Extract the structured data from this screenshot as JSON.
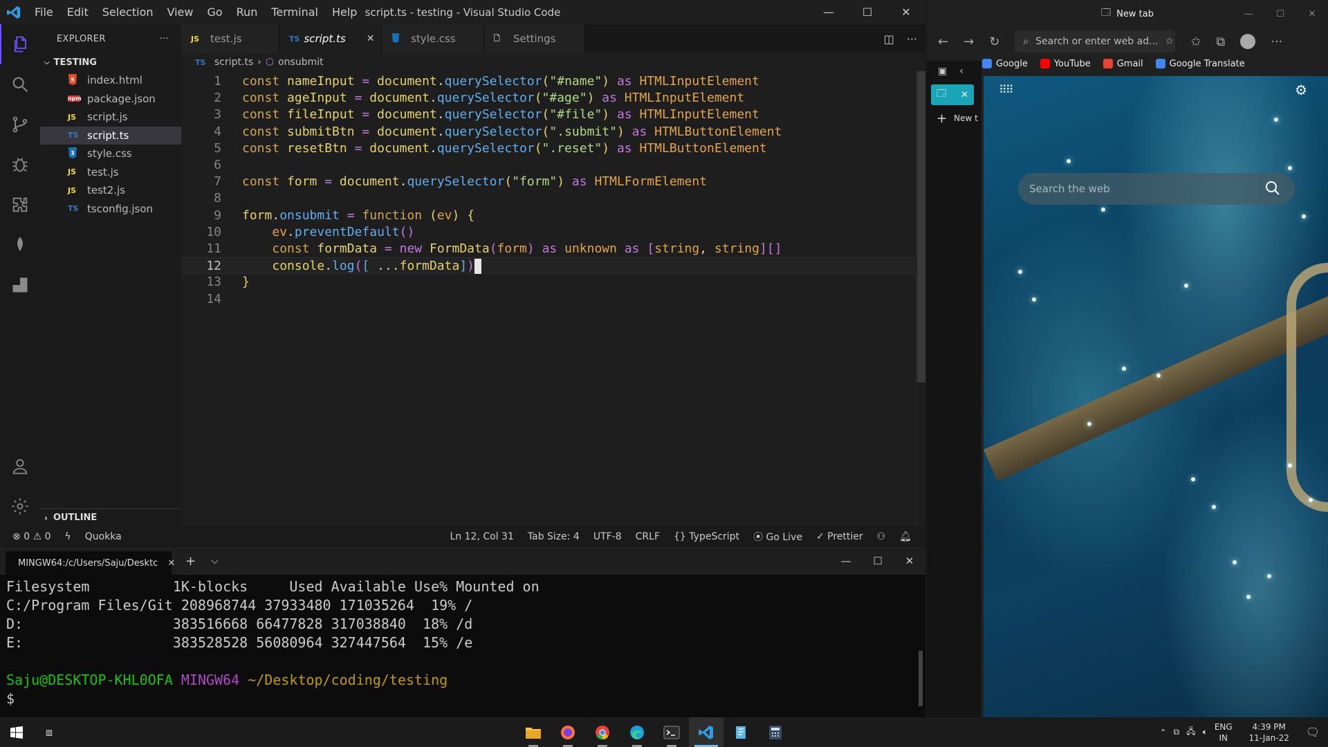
{
  "vscode": {
    "menu": [
      "File",
      "Edit",
      "Selection",
      "View",
      "Go",
      "Run",
      "Terminal",
      "Help"
    ],
    "window_title": "script.ts - testing - Visual Studio Code",
    "explorer": {
      "header": "EXPLORER",
      "more": "···",
      "folder": "TESTING",
      "files": [
        {
          "name": "index.html",
          "badge": "5",
          "color": "#e44d26"
        },
        {
          "name": "package.json",
          "badge": "npm",
          "color": "#cb3837"
        },
        {
          "name": "script.js",
          "badge": "JS",
          "color": "#f1dd35"
        },
        {
          "name": "script.ts",
          "badge": "TS",
          "color": "#3178c6"
        },
        {
          "name": "style.css",
          "badge": "3",
          "color": "#1572b6"
        },
        {
          "name": "test.js",
          "badge": "JS",
          "color": "#f1dd35"
        },
        {
          "name": "test2.js",
          "badge": "JS",
          "color": "#f1dd35"
        },
        {
          "name": "tsconfig.json",
          "badge": "TS",
          "color": "#3178c6"
        }
      ],
      "outline": "OUTLINE"
    },
    "tabs": [
      {
        "label": "test.js",
        "badge": "JS",
        "color": "#f1dd35"
      },
      {
        "label": "script.ts",
        "badge": "TS",
        "color": "#3178c6",
        "close": "✕"
      },
      {
        "label": "style.css",
        "badge": "3",
        "color": "#1572b6"
      },
      {
        "label": "Settings",
        "badge": "🗋",
        "color": "#cccccc"
      }
    ],
    "breadcrumb": {
      "file": "script.ts",
      "symbol": "onsubmit"
    },
    "editor": {
      "line_numbers": [
        "1",
        "2",
        "3",
        "4",
        "5",
        "6",
        "7",
        "8",
        "9",
        "10",
        "11",
        "12",
        "13",
        "14"
      ],
      "current_line": 12,
      "lines": [
        [
          [
            "kw",
            "const"
          ],
          [
            "plain",
            " "
          ],
          [
            "var",
            "nameInput"
          ],
          [
            "plain",
            " "
          ],
          [
            "op",
            "="
          ],
          [
            "plain",
            " "
          ],
          [
            "var",
            "document"
          ],
          [
            "plain",
            "."
          ],
          [
            "fn",
            "querySelector"
          ],
          [
            "var",
            "("
          ],
          [
            "str",
            "\"#name\""
          ],
          [
            "var",
            ")"
          ],
          [
            "plain",
            " "
          ],
          [
            "op",
            "as"
          ],
          [
            "plain",
            " "
          ],
          [
            "typ",
            "HTMLInputElement"
          ]
        ],
        [
          [
            "kw",
            "const"
          ],
          [
            "plain",
            " "
          ],
          [
            "var",
            "ageInput"
          ],
          [
            "plain",
            " "
          ],
          [
            "op",
            "="
          ],
          [
            "plain",
            " "
          ],
          [
            "var",
            "document"
          ],
          [
            "plain",
            "."
          ],
          [
            "fn",
            "querySelector"
          ],
          [
            "var",
            "("
          ],
          [
            "str",
            "\"#age\""
          ],
          [
            "var",
            ")"
          ],
          [
            "plain",
            " "
          ],
          [
            "op",
            "as"
          ],
          [
            "plain",
            " "
          ],
          [
            "typ",
            "HTMLInputElement"
          ]
        ],
        [
          [
            "kw",
            "const"
          ],
          [
            "plain",
            " "
          ],
          [
            "var",
            "fileInput"
          ],
          [
            "plain",
            " "
          ],
          [
            "op",
            "="
          ],
          [
            "plain",
            " "
          ],
          [
            "var",
            "document"
          ],
          [
            "plain",
            "."
          ],
          [
            "fn",
            "querySelector"
          ],
          [
            "var",
            "("
          ],
          [
            "str",
            "\"#file\""
          ],
          [
            "var",
            ")"
          ],
          [
            "plain",
            " "
          ],
          [
            "op",
            "as"
          ],
          [
            "plain",
            " "
          ],
          [
            "typ",
            "HTMLInputElement"
          ]
        ],
        [
          [
            "kw",
            "const"
          ],
          [
            "plain",
            " "
          ],
          [
            "var",
            "submitBtn"
          ],
          [
            "plain",
            " "
          ],
          [
            "op",
            "="
          ],
          [
            "plain",
            " "
          ],
          [
            "var",
            "document"
          ],
          [
            "plain",
            "."
          ],
          [
            "fn",
            "querySelector"
          ],
          [
            "var",
            "("
          ],
          [
            "str",
            "\".submit\""
          ],
          [
            "var",
            ")"
          ],
          [
            "plain",
            " "
          ],
          [
            "op",
            "as"
          ],
          [
            "plain",
            " "
          ],
          [
            "typ",
            "HTMLButtonElement"
          ]
        ],
        [
          [
            "kw",
            "const"
          ],
          [
            "plain",
            " "
          ],
          [
            "var",
            "resetBtn"
          ],
          [
            "plain",
            " "
          ],
          [
            "op",
            "="
          ],
          [
            "plain",
            " "
          ],
          [
            "var",
            "document"
          ],
          [
            "plain",
            "."
          ],
          [
            "fn",
            "querySelector"
          ],
          [
            "var",
            "("
          ],
          [
            "str",
            "\".reset\""
          ],
          [
            "var",
            ")"
          ],
          [
            "plain",
            " "
          ],
          [
            "op",
            "as"
          ],
          [
            "plain",
            " "
          ],
          [
            "typ",
            "HTMLButtonElement"
          ]
        ],
        [],
        [
          [
            "kw",
            "const"
          ],
          [
            "plain",
            " "
          ],
          [
            "var",
            "form"
          ],
          [
            "plain",
            " "
          ],
          [
            "op",
            "="
          ],
          [
            "plain",
            " "
          ],
          [
            "var",
            "document"
          ],
          [
            "plain",
            "."
          ],
          [
            "fn",
            "querySelector"
          ],
          [
            "var",
            "("
          ],
          [
            "str",
            "\"form\""
          ],
          [
            "var",
            ")"
          ],
          [
            "plain",
            " "
          ],
          [
            "op",
            "as"
          ],
          [
            "plain",
            " "
          ],
          [
            "typ",
            "HTMLFormElement"
          ]
        ],
        [],
        [
          [
            "var",
            "form"
          ],
          [
            "plain",
            "."
          ],
          [
            "fn",
            "onsubmit"
          ],
          [
            "plain",
            " "
          ],
          [
            "op",
            "="
          ],
          [
            "plain",
            " "
          ],
          [
            "kw",
            "function"
          ],
          [
            "plain",
            " "
          ],
          [
            "var",
            "("
          ],
          [
            "typ",
            "ev"
          ],
          [
            "var",
            ")"
          ],
          [
            "plain",
            " "
          ],
          [
            "var",
            "{"
          ]
        ],
        [
          [
            "plain",
            "    "
          ],
          [
            "typ",
            "ev"
          ],
          [
            "plain",
            "."
          ],
          [
            "fn",
            "preventDefault"
          ],
          [
            "op",
            "()"
          ]
        ],
        [
          [
            "plain",
            "    "
          ],
          [
            "kw",
            "const"
          ],
          [
            "plain",
            " "
          ],
          [
            "var",
            "formData"
          ],
          [
            "plain",
            " "
          ],
          [
            "op",
            "="
          ],
          [
            "plain",
            " "
          ],
          [
            "op",
            "new"
          ],
          [
            "plain",
            " "
          ],
          [
            "var",
            "FormData"
          ],
          [
            "op",
            "("
          ],
          [
            "typ",
            "form"
          ],
          [
            "op",
            ")"
          ],
          [
            "plain",
            " "
          ],
          [
            "op",
            "as"
          ],
          [
            "plain",
            " "
          ],
          [
            "typ",
            "unknown"
          ],
          [
            "plain",
            " "
          ],
          [
            "op",
            "as"
          ],
          [
            "plain",
            " "
          ],
          [
            "op",
            "["
          ],
          [
            "typ",
            "string"
          ],
          [
            "plain",
            ", "
          ],
          [
            "typ",
            "string"
          ],
          [
            "op",
            "][]"
          ]
        ],
        [
          [
            "plain",
            "    "
          ],
          [
            "var",
            "console"
          ],
          [
            "plain",
            "."
          ],
          [
            "fn",
            "log"
          ],
          [
            "op",
            "("
          ],
          [
            "fn",
            "["
          ],
          [
            "plain",
            " ..."
          ],
          [
            "var",
            "formData"
          ],
          [
            "fn",
            "]"
          ],
          [
            "op",
            ")"
          ]
        ],
        [
          [
            "var",
            "}"
          ]
        ],
        []
      ]
    },
    "status": {
      "errors": "0",
      "warnings": "0",
      "quokka": "Quokka",
      "position": "Ln 12, Col 31",
      "tab_size": "Tab Size: 4",
      "encoding": "UTF-8",
      "eol": "CRLF",
      "language": "TypeScript",
      "go_live": "Go Live",
      "prettier": "Prettier"
    }
  },
  "terminal": {
    "tab_title": "MINGW64:/c/Users/Saju/Desktc",
    "output_lines": [
      "Filesystem          1K-blocks     Used Available Use% Mounted on",
      "C:/Program Files/Git 208968744 37933480 171035264  19% /",
      "D:                  383516668 66477828 317038840  18% /d",
      "E:                  383528528 56080964 327447564  15% /e",
      ""
    ],
    "prompt": {
      "user": "Saju@DESKTOP-KHL0OFA",
      "shell": "MINGW64",
      "path": "~/Desktop/coding/testing",
      "symbol": "$"
    }
  },
  "edge": {
    "tab_title": "New tab",
    "address_placeholder": "Search or enter web ad...",
    "bookmarks": [
      {
        "label": "Google",
        "color": "#4285f4"
      },
      {
        "label": "YouTube",
        "color": "#ff0000"
      },
      {
        "label": "Gmail",
        "color": "#ea4335"
      },
      {
        "label": "Google Translate",
        "color": "#4285f4"
      }
    ],
    "vertical_new_tab": "New t",
    "search_placeholder": "Search the web"
  },
  "taskbar": {
    "language": {
      "line1": "ENG",
      "line2": "IN"
    },
    "time": "4:39 PM",
    "date": "11-Jan-22"
  }
}
